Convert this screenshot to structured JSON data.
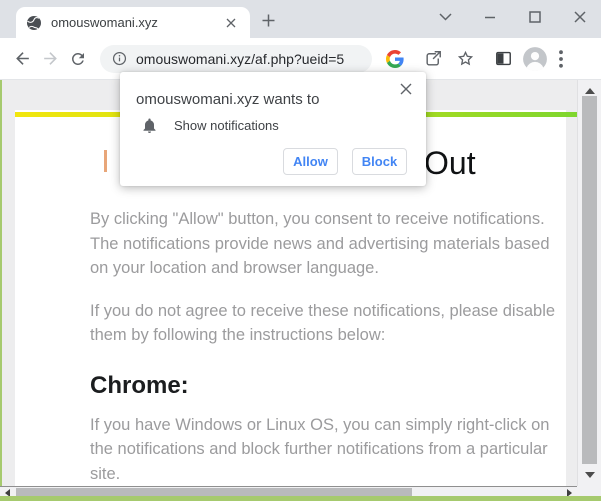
{
  "tab": {
    "title": "omouswomani.xyz"
  },
  "toolbar": {
    "url": "omouswomani.xyz/af.php?ueid=5"
  },
  "permission_dialog": {
    "title": "omouswomani.xyz wants to",
    "permission_label": "Show notifications",
    "allow_label": "Allow",
    "block_label": "Block"
  },
  "page": {
    "heading_visible": "Out",
    "intro": "By clicking \"Allow\" button, you consent to receive notifications. The notifications provide news and advertising materials based on your location and browser language.",
    "disagree": "If you do not agree to receive these notifications, please disable them by following the instructions below:",
    "chrome_heading": "Chrome:",
    "chrome_instructions": "If you have Windows or Linux OS, you can simply right-click on the notifications and block further notifications from a particular site."
  },
  "colors": {
    "accent_bar_start": "#f2e60d",
    "accent_bar_end": "#7ed62e",
    "page_edge_green": "#a6ca6e",
    "dialog_button_blue": "#4285f4"
  }
}
